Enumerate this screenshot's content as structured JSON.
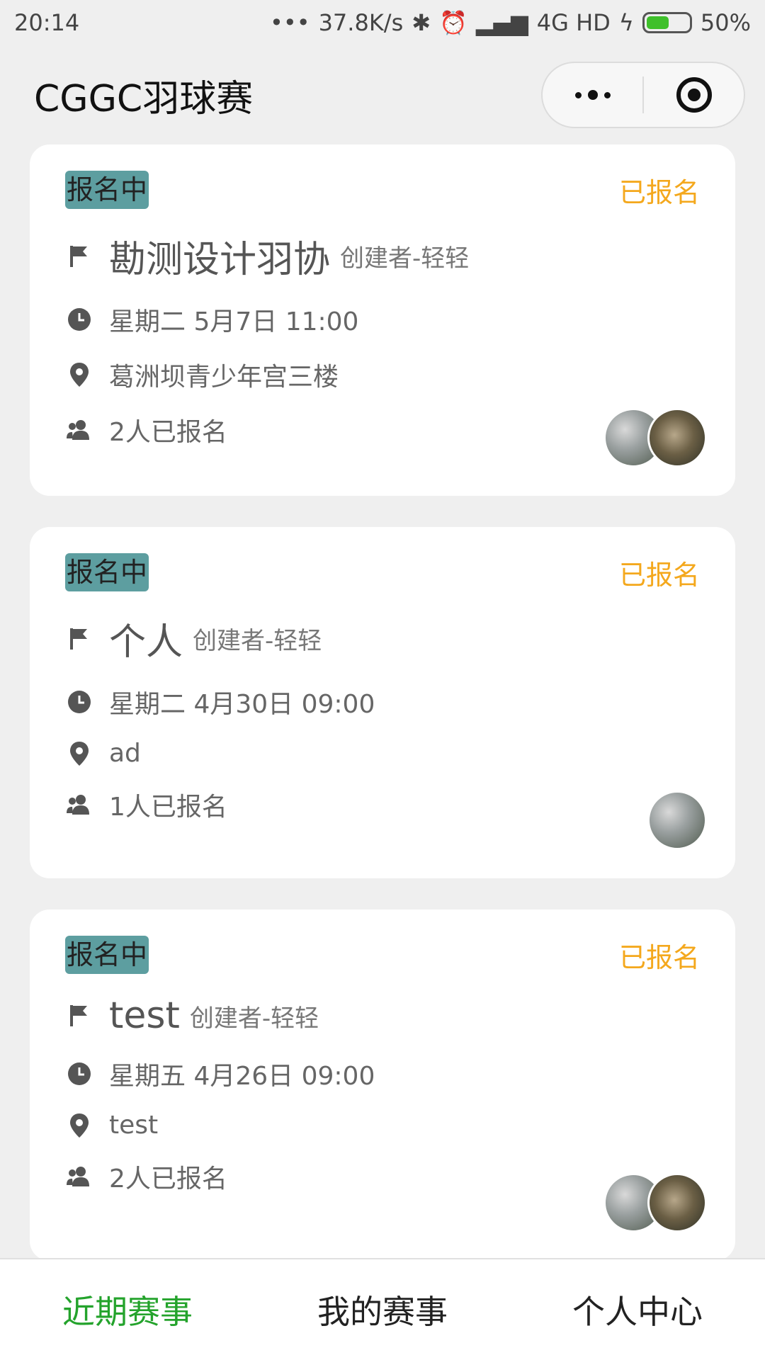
{
  "status_bar": {
    "time": "20:14",
    "net_speed": "37.8K/s",
    "network": "4G HD",
    "battery": "50%",
    "battery_level": 0.5
  },
  "header": {
    "title": "CGGC羽球赛"
  },
  "events": [
    {
      "status": "报名中",
      "signed": "已报名",
      "name": "勘测设计羽协",
      "creator": "创建者-轻轻",
      "time": "星期二 5月7日 11:00",
      "location": "葛洲坝青少年宫三楼",
      "count": "2人已报名"
    },
    {
      "status": "报名中",
      "signed": "已报名",
      "name": "个人",
      "creator": "创建者-轻轻",
      "time": "星期二 4月30日 09:00",
      "location": "ad",
      "count": "1人已报名"
    },
    {
      "status": "报名中",
      "signed": "已报名",
      "name": "test",
      "creator": "创建者-轻轻",
      "time": "星期五 4月26日 09:00",
      "location": "test",
      "count": "2人已报名"
    }
  ],
  "tabs": [
    {
      "label": "近期赛事",
      "active": true
    },
    {
      "label": "我的赛事",
      "active": false
    },
    {
      "label": "个人中心",
      "active": false
    }
  ],
  "colors": {
    "accent": "#24a32c",
    "signed": "#f4a81d",
    "badge": "#5d9ea0"
  }
}
